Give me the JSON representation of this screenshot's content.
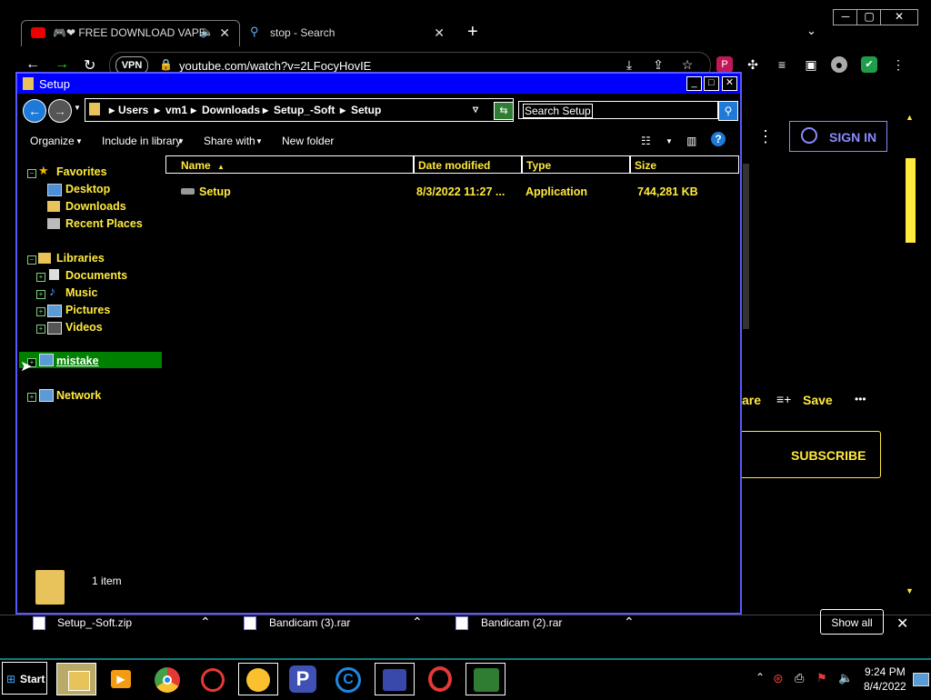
{
  "browser": {
    "tabs": [
      {
        "label": "🎮❤ FREE DOWNLOAD VAPE",
        "active": true
      },
      {
        "label": "stop - Search",
        "active": false
      }
    ],
    "new_tab": "+",
    "url": "youtube.com/watch?v=2LFocyHovIE",
    "vpn_label": "VPN",
    "window_controls": {
      "minimize": "─",
      "maximize": "▢",
      "close": "✕"
    },
    "accent_yellow": "#ffea3d"
  },
  "youtube": {
    "sign_in": "SIGN IN",
    "share_partial": "are",
    "save": "Save",
    "more": "•••",
    "subscribe": "SUBSCRIBE"
  },
  "explorer": {
    "title": "Setup",
    "address": [
      "Users",
      "vm1",
      "Downloads",
      "Setup_-Soft",
      "Setup"
    ],
    "search_placeholder": "Search Setup",
    "commands": {
      "organize": "Organize",
      "include_in_library": "Include in library",
      "share_with": "Share with",
      "new_folder": "New folder"
    },
    "nav": {
      "favorites": "Favorites",
      "favorites_items": [
        "Desktop",
        "Downloads",
        "Recent Places"
      ],
      "libraries": "Libraries",
      "libraries_items": [
        "Documents",
        "Music",
        "Pictures",
        "Videos"
      ],
      "computer": "mistake",
      "network": "Network"
    },
    "columns": {
      "name": "Name",
      "date": "Date modified",
      "type": "Type",
      "size": "Size"
    },
    "files": [
      {
        "name": "Setup",
        "date": "8/3/2022 11:27 ...",
        "type": "Application",
        "size": "744,281 KB"
      }
    ],
    "status": "1 item",
    "selection_color": "#008000",
    "title_color": "#0000ff"
  },
  "downloads": {
    "items": [
      "Setup_-Soft.zip",
      "Bandicam (3).rar",
      "Bandicam (2).rar"
    ],
    "show_all": "Show all",
    "close": "✕"
  },
  "taskbar": {
    "start": "Start",
    "time": "9:24 PM",
    "date": "8/4/2022"
  }
}
